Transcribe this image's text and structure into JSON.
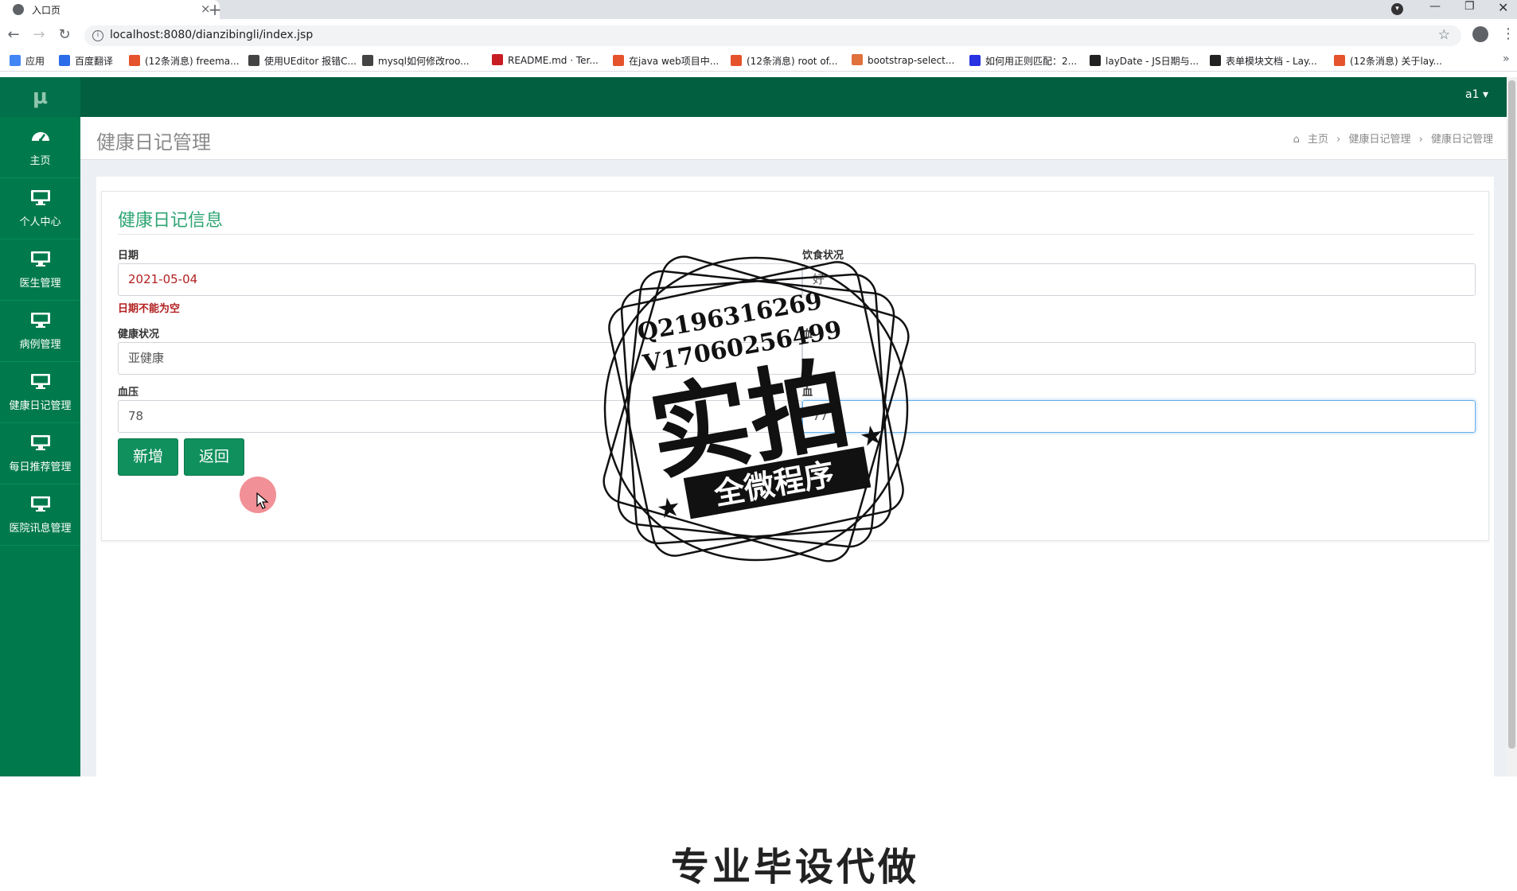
{
  "browser": {
    "tab_title": "入口页",
    "tab_close": "×",
    "new_tab": "+",
    "url": "localhost:8080/dianzibingli/index.jsp",
    "bookmarks": [
      {
        "label": "应用",
        "color": "#4285f4"
      },
      {
        "label": "百度翻译",
        "color": "#2b6de8"
      },
      {
        "label": "(12条消息) freema...",
        "color": "#e5532d"
      },
      {
        "label": "使用UEditor 报错C...",
        "color": "#444444"
      },
      {
        "label": "mysql如何修改roo...",
        "color": "#444444"
      },
      {
        "label": "README.md · Ter...",
        "color": "#c71d23"
      },
      {
        "label": "在java web项目中...",
        "color": "#e5532d"
      },
      {
        "label": "(12条消息) root of...",
        "color": "#e5532d"
      },
      {
        "label": "bootstrap-select...",
        "color": "#e0703c"
      },
      {
        "label": "如何用正则匹配：2...",
        "color": "#2932e1"
      },
      {
        "label": "layDate - JS日期与...",
        "color": "#222222"
      },
      {
        "label": "表单模块文档 - Lay...",
        "color": "#222222"
      },
      {
        "label": "(12条消息) 关于lay...",
        "color": "#e5532d"
      }
    ]
  },
  "app": {
    "logo": "μ",
    "user": "a1 ▾",
    "sidebar": [
      {
        "label": "主页",
        "icon": "dashboard-icon"
      },
      {
        "label": "个人中心",
        "icon": "monitor-icon"
      },
      {
        "label": "医生管理",
        "icon": "monitor-icon"
      },
      {
        "label": "病例管理",
        "icon": "monitor-icon"
      },
      {
        "label": "健康日记管理",
        "icon": "monitor-icon"
      },
      {
        "label": "每日推荐管理",
        "icon": "monitor-icon"
      },
      {
        "label": "医院讯息管理",
        "icon": "monitor-icon"
      }
    ],
    "header": {
      "title": "健康日记管理",
      "breadcrumb": [
        "主页",
        "健康日记管理",
        "健康日记管理"
      ]
    },
    "form": {
      "title": "健康日记信息",
      "date_label": "日期",
      "date_value": "2021-05-04",
      "date_error": "日期不能为空",
      "diet_label": "饮食状况",
      "diet_value": "好",
      "health_label": "健康状况",
      "health_value": "亚健康",
      "blood_label": "血压",
      "blood_value": "78",
      "right2_label": "血",
      "right3_label": "血",
      "right3_value": "77",
      "add_button": "新增",
      "back_button": "返回"
    }
  },
  "watermark": {
    "line1": "Q2196316269",
    "line2": "V17060256499",
    "big": "实拍",
    "banner": "全微程序"
  },
  "bottom_text": "专业毕设代做"
}
